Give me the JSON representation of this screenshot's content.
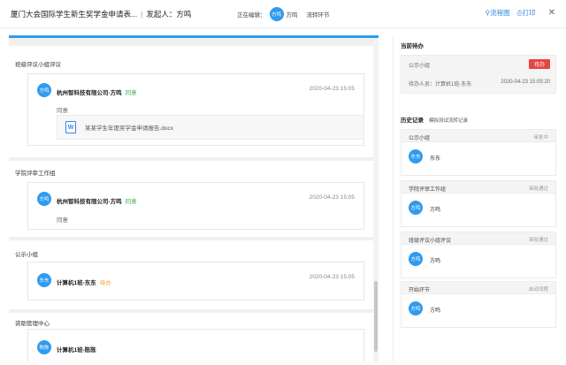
{
  "header": {
    "title": "厦门大会国际学生新生奖学金申请表...",
    "separator": "|",
    "initiator_label": "发起人：方鸣",
    "viewing_label": "正在编辑：",
    "viewing_avatar": "方鸣",
    "viewing_user": "方鸣",
    "flow_link": "流转环节",
    "flowchart_button": "流程图",
    "print_button": "打印",
    "close_glyph": "✕"
  },
  "main": {
    "sections": [
      {
        "title": "班级评议小组评议",
        "card": {
          "avatar": "方鸣",
          "name": "杭州智科技有限公司-方鸣",
          "status": "同意",
          "time": "2020-04-23 15:05",
          "comment": "同意",
          "attachment": {
            "icon": "W",
            "filename": "某某学生年度奖学金申请报告.docx"
          }
        }
      },
      {
        "title": "学院评审工作组",
        "card": {
          "avatar": "方鸣",
          "name": "杭州智科技有限公司-方鸣",
          "status": "同意",
          "time": "2020-04-23 15:05",
          "comment": "同意"
        }
      },
      {
        "title": "公示小组",
        "card": {
          "avatar": "东东",
          "name": "计算机1班-东东",
          "status": "待办",
          "time": "2020-04-23 15:05"
        }
      },
      {
        "title": "资助管理中心",
        "card": {
          "avatar": "陈陈",
          "name": "计算机1班-陈陈"
        }
      }
    ]
  },
  "sidebar": {
    "pending_title": "当前待办",
    "pending": {
      "node": "公示小组",
      "badge": "待办",
      "assignee": "待办人员：计算机1班-东东",
      "time": "2020-04-23 15:05:20"
    },
    "history_title": "历史记录",
    "history_sub": "模拟测试流转记录",
    "history": [
      {
        "node": "公示小组",
        "state": "审批中",
        "avatar": "东东",
        "name": "东东"
      },
      {
        "node": "学院评审工作组",
        "state": "审批通过",
        "avatar": "方鸣",
        "name": "方鸣"
      },
      {
        "node": "班级评议小组评议",
        "state": "审批通过",
        "avatar": "方鸣",
        "name": "方鸣"
      },
      {
        "node": "开始环节",
        "state": "启动流程",
        "avatar": "方鸣",
        "name": "方鸣"
      }
    ]
  },
  "colors": {
    "accent": "#2f9bf0",
    "approve": "#3bb54a",
    "pending": "#f2a13a",
    "badge": "#e64545"
  }
}
